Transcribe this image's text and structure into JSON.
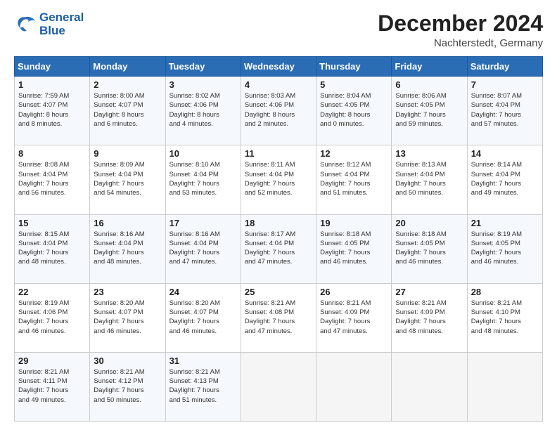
{
  "header": {
    "logo_line1": "General",
    "logo_line2": "Blue",
    "month_title": "December 2024",
    "location": "Nachterstedt, Germany"
  },
  "weekdays": [
    "Sunday",
    "Monday",
    "Tuesday",
    "Wednesday",
    "Thursday",
    "Friday",
    "Saturday"
  ],
  "weeks": [
    [
      {
        "day": "1",
        "text": "Sunrise: 7:59 AM\nSunset: 4:07 PM\nDaylight: 8 hours\nand 8 minutes."
      },
      {
        "day": "2",
        "text": "Sunrise: 8:00 AM\nSunset: 4:07 PM\nDaylight: 8 hours\nand 6 minutes."
      },
      {
        "day": "3",
        "text": "Sunrise: 8:02 AM\nSunset: 4:06 PM\nDaylight: 8 hours\nand 4 minutes."
      },
      {
        "day": "4",
        "text": "Sunrise: 8:03 AM\nSunset: 4:06 PM\nDaylight: 8 hours\nand 2 minutes."
      },
      {
        "day": "5",
        "text": "Sunrise: 8:04 AM\nSunset: 4:05 PM\nDaylight: 8 hours\nand 0 minutes."
      },
      {
        "day": "6",
        "text": "Sunrise: 8:06 AM\nSunset: 4:05 PM\nDaylight: 7 hours\nand 59 minutes."
      },
      {
        "day": "7",
        "text": "Sunrise: 8:07 AM\nSunset: 4:04 PM\nDaylight: 7 hours\nand 57 minutes."
      }
    ],
    [
      {
        "day": "8",
        "text": "Sunrise: 8:08 AM\nSunset: 4:04 PM\nDaylight: 7 hours\nand 56 minutes."
      },
      {
        "day": "9",
        "text": "Sunrise: 8:09 AM\nSunset: 4:04 PM\nDaylight: 7 hours\nand 54 minutes."
      },
      {
        "day": "10",
        "text": "Sunrise: 8:10 AM\nSunset: 4:04 PM\nDaylight: 7 hours\nand 53 minutes."
      },
      {
        "day": "11",
        "text": "Sunrise: 8:11 AM\nSunset: 4:04 PM\nDaylight: 7 hours\nand 52 minutes."
      },
      {
        "day": "12",
        "text": "Sunrise: 8:12 AM\nSunset: 4:04 PM\nDaylight: 7 hours\nand 51 minutes."
      },
      {
        "day": "13",
        "text": "Sunrise: 8:13 AM\nSunset: 4:04 PM\nDaylight: 7 hours\nand 50 minutes."
      },
      {
        "day": "14",
        "text": "Sunrise: 8:14 AM\nSunset: 4:04 PM\nDaylight: 7 hours\nand 49 minutes."
      }
    ],
    [
      {
        "day": "15",
        "text": "Sunrise: 8:15 AM\nSunset: 4:04 PM\nDaylight: 7 hours\nand 48 minutes."
      },
      {
        "day": "16",
        "text": "Sunrise: 8:16 AM\nSunset: 4:04 PM\nDaylight: 7 hours\nand 48 minutes."
      },
      {
        "day": "17",
        "text": "Sunrise: 8:16 AM\nSunset: 4:04 PM\nDaylight: 7 hours\nand 47 minutes."
      },
      {
        "day": "18",
        "text": "Sunrise: 8:17 AM\nSunset: 4:04 PM\nDaylight: 7 hours\nand 47 minutes."
      },
      {
        "day": "19",
        "text": "Sunrise: 8:18 AM\nSunset: 4:05 PM\nDaylight: 7 hours\nand 46 minutes."
      },
      {
        "day": "20",
        "text": "Sunrise: 8:18 AM\nSunset: 4:05 PM\nDaylight: 7 hours\nand 46 minutes."
      },
      {
        "day": "21",
        "text": "Sunrise: 8:19 AM\nSunset: 4:05 PM\nDaylight: 7 hours\nand 46 minutes."
      }
    ],
    [
      {
        "day": "22",
        "text": "Sunrise: 8:19 AM\nSunset: 4:06 PM\nDaylight: 7 hours\nand 46 minutes."
      },
      {
        "day": "23",
        "text": "Sunrise: 8:20 AM\nSunset: 4:07 PM\nDaylight: 7 hours\nand 46 minutes."
      },
      {
        "day": "24",
        "text": "Sunrise: 8:20 AM\nSunset: 4:07 PM\nDaylight: 7 hours\nand 46 minutes."
      },
      {
        "day": "25",
        "text": "Sunrise: 8:21 AM\nSunset: 4:08 PM\nDaylight: 7 hours\nand 47 minutes."
      },
      {
        "day": "26",
        "text": "Sunrise: 8:21 AM\nSunset: 4:09 PM\nDaylight: 7 hours\nand 47 minutes."
      },
      {
        "day": "27",
        "text": "Sunrise: 8:21 AM\nSunset: 4:09 PM\nDaylight: 7 hours\nand 48 minutes."
      },
      {
        "day": "28",
        "text": "Sunrise: 8:21 AM\nSunset: 4:10 PM\nDaylight: 7 hours\nand 48 minutes."
      }
    ],
    [
      {
        "day": "29",
        "text": "Sunrise: 8:21 AM\nSunset: 4:11 PM\nDaylight: 7 hours\nand 49 minutes."
      },
      {
        "day": "30",
        "text": "Sunrise: 8:21 AM\nSunset: 4:12 PM\nDaylight: 7 hours\nand 50 minutes."
      },
      {
        "day": "31",
        "text": "Sunrise: 8:21 AM\nSunset: 4:13 PM\nDaylight: 7 hours\nand 51 minutes."
      },
      {
        "day": "",
        "text": ""
      },
      {
        "day": "",
        "text": ""
      },
      {
        "day": "",
        "text": ""
      },
      {
        "day": "",
        "text": ""
      }
    ]
  ]
}
